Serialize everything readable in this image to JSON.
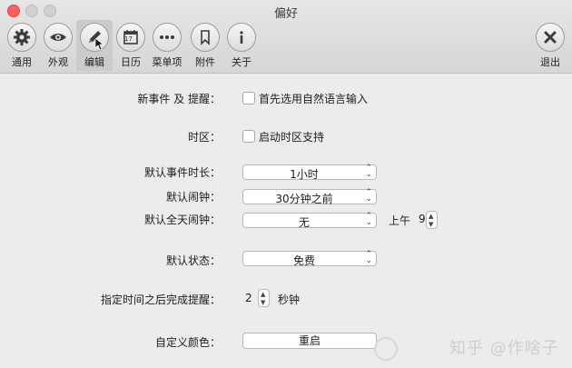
{
  "window": {
    "title": "偏好"
  },
  "toolbar": {
    "items": [
      {
        "label": "通用",
        "icon": "gear-icon"
      },
      {
        "label": "外观",
        "icon": "eye-icon"
      },
      {
        "label": "编辑",
        "icon": "pencil-icon",
        "selected": true
      },
      {
        "label": "日历",
        "icon": "calendar-icon",
        "badge": "17"
      },
      {
        "label": "菜单项",
        "icon": "more-icon"
      },
      {
        "label": "附件",
        "icon": "bookmark-icon"
      },
      {
        "label": "关于",
        "icon": "info-icon"
      }
    ],
    "quit_label": "退出"
  },
  "form": {
    "new_event_label": "新事件 及 提醒：",
    "natural_language_checkbox": "首先选用自然语言输入",
    "timezone_label": "时区：",
    "timezone_checkbox": "启动时区支持",
    "duration_label": "默认事件时长：",
    "duration_value": "1小时",
    "alarm_label": "默认闹钟：",
    "alarm_value": "30分钟之前",
    "allday_alarm_label": "默认全天闹钟：",
    "allday_alarm_value": "无",
    "allday_time_prefix": "上午",
    "allday_time_value": "9",
    "status_label": "默认状态：",
    "status_value": "免费",
    "complete_reminder_label": "指定时间之后完成提醒：",
    "complete_reminder_value": "2",
    "complete_reminder_unit": "秒钟",
    "custom_color_label": "自定义颜色：",
    "reset_button": "重启"
  },
  "watermark": "知乎 @作啥子"
}
